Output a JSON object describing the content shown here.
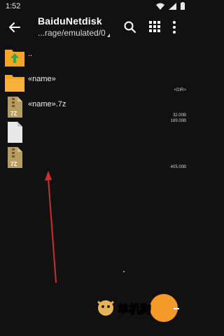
{
  "status": {
    "time": "1:52"
  },
  "header": {
    "title": "BaiduNetdisk",
    "path": "...rage/emulated/0"
  },
  "rows": [
    {
      "name": "..",
      "meta": "",
      "icon": "folder-up-icon"
    },
    {
      "name": "«name»",
      "meta": "<DIR>",
      "icon": "folder-icon"
    },
    {
      "name": "«name».7z",
      "meta": "32.00B",
      "icon": "archive-7z-icon"
    },
    {
      "name": "",
      "meta": "189.00B",
      "icon": "file-icon"
    },
    {
      "name": "",
      "meta": "405.00B",
      "icon": "archive-7z-icon"
    }
  ],
  "archive_badge": "7Z",
  "watermark": {
    "text": "单机狗"
  },
  "colors": {
    "accent": "#f39a2b",
    "folder": "#f6a623",
    "arrow": "#d02d2d"
  }
}
